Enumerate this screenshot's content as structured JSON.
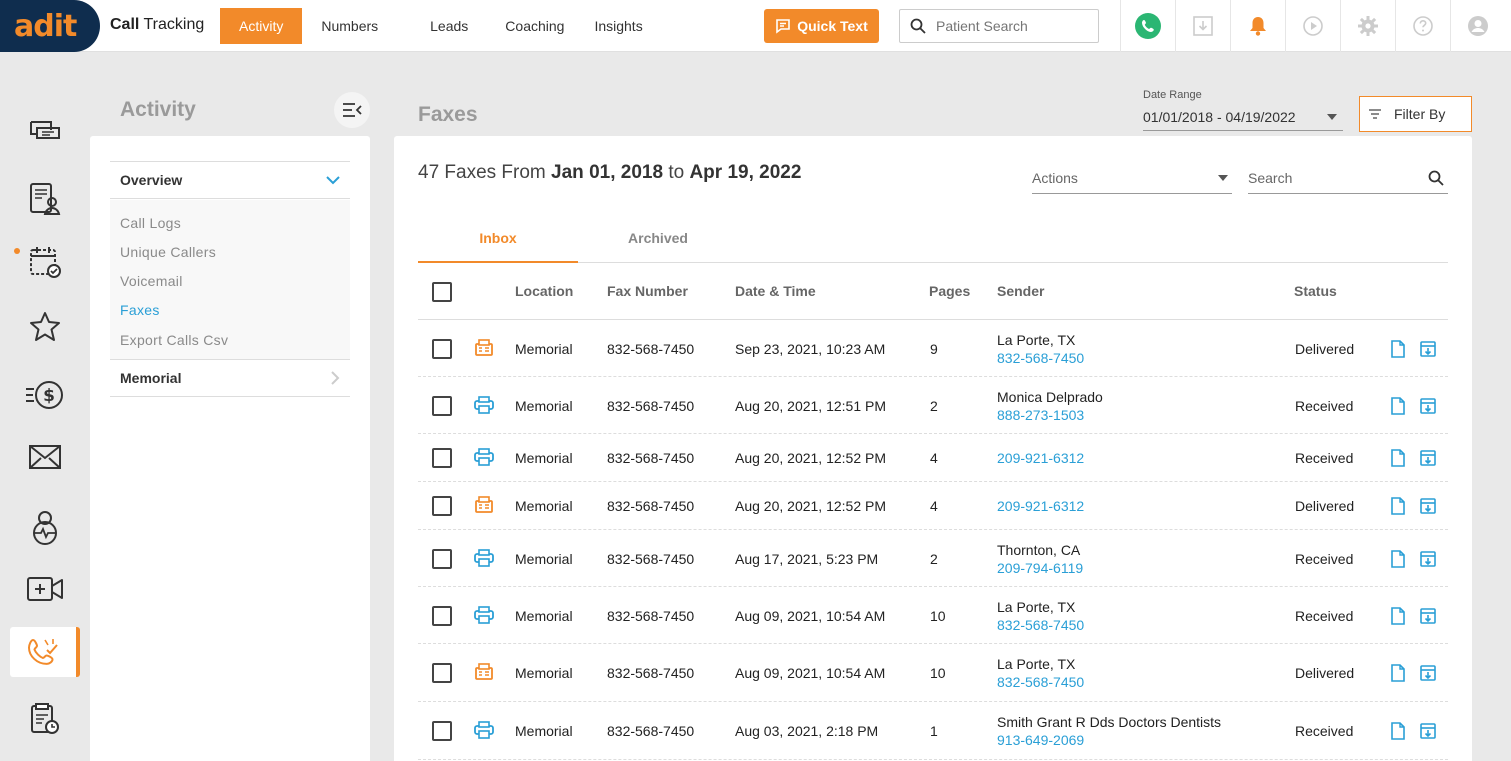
{
  "brand": {
    "logo": "adit",
    "product_bold": "Call",
    "product_rest": "Tracking"
  },
  "nav": [
    {
      "label": "Activity",
      "active": true
    },
    {
      "label": "Numbers",
      "active": false
    },
    {
      "label": "Leads",
      "active": false
    },
    {
      "label": "Coaching",
      "active": false
    },
    {
      "label": "Insights",
      "active": false
    }
  ],
  "quick_text": "Quick Text",
  "patient_search": {
    "placeholder": "Patient Search"
  },
  "sidebar": {
    "title": "Activity",
    "overview": "Overview",
    "links": [
      "Call Logs",
      "Unique Callers",
      "Voicemail",
      "Faxes",
      "Export Calls Csv"
    ],
    "active_link": "Faxes",
    "location": "Memorial"
  },
  "page": {
    "title": "Faxes",
    "date_range_label": "Date Range",
    "date_range_value": "01/01/2018 - 04/19/2022",
    "filter_label": "Filter By"
  },
  "summary": {
    "prefix": "47 Faxes From",
    "from": "Jan 01, 2018",
    "to_word": "to",
    "to": "Apr 19, 2022"
  },
  "actions_label": "Actions",
  "search_placeholder": "Search",
  "tabs": [
    {
      "label": "Inbox",
      "active": true
    },
    {
      "label": "Archived",
      "active": false
    }
  ],
  "columns": {
    "location": "Location",
    "fax_number": "Fax Number",
    "datetime": "Date & Time",
    "pages": "Pages",
    "sender": "Sender",
    "status": "Status"
  },
  "rows": [
    {
      "type": "sent",
      "location": "Memorial",
      "fax_number": "832-568-7450",
      "datetime": "Sep 23, 2021, 10:23 AM",
      "pages": "9",
      "sender_name": "La Porte, TX",
      "sender_phone": "832-568-7450",
      "status": "Delivered"
    },
    {
      "type": "received",
      "location": "Memorial",
      "fax_number": "832-568-7450",
      "datetime": "Aug 20, 2021, 12:51 PM",
      "pages": "2",
      "sender_name": "Monica Delprado",
      "sender_phone": "888-273-1503",
      "status": "Received"
    },
    {
      "type": "received",
      "location": "Memorial",
      "fax_number": "832-568-7450",
      "datetime": "Aug 20, 2021, 12:52 PM",
      "pages": "4",
      "sender_name": "",
      "sender_phone": "209-921-6312",
      "status": "Received"
    },
    {
      "type": "sent",
      "location": "Memorial",
      "fax_number": "832-568-7450",
      "datetime": "Aug 20, 2021, 12:52 PM",
      "pages": "4",
      "sender_name": "",
      "sender_phone": "209-921-6312",
      "status": "Delivered"
    },
    {
      "type": "received",
      "location": "Memorial",
      "fax_number": "832-568-7450",
      "datetime": "Aug 17, 2021, 5:23 PM",
      "pages": "2",
      "sender_name": "Thornton, CA",
      "sender_phone": "209-794-6119",
      "status": "Received"
    },
    {
      "type": "received",
      "location": "Memorial",
      "fax_number": "832-568-7450",
      "datetime": "Aug 09, 2021, 10:54 AM",
      "pages": "10",
      "sender_name": "La Porte, TX",
      "sender_phone": "832-568-7450",
      "status": "Received"
    },
    {
      "type": "sent",
      "location": "Memorial",
      "fax_number": "832-568-7450",
      "datetime": "Aug 09, 2021, 10:54 AM",
      "pages": "10",
      "sender_name": "La Porte, TX",
      "sender_phone": "832-568-7450",
      "status": "Delivered"
    },
    {
      "type": "received",
      "location": "Memorial",
      "fax_number": "832-568-7450",
      "datetime": "Aug 03, 2021, 2:18 PM",
      "pages": "1",
      "sender_name": "Smith Grant R Dds Doctors Dentists",
      "sender_phone": "913-649-2069",
      "status": "Received"
    }
  ],
  "colors": {
    "accent": "#f28a2a",
    "link": "#2a9fd6",
    "brand_dark": "#0f2d4e",
    "phone_green": "#2bb673"
  }
}
